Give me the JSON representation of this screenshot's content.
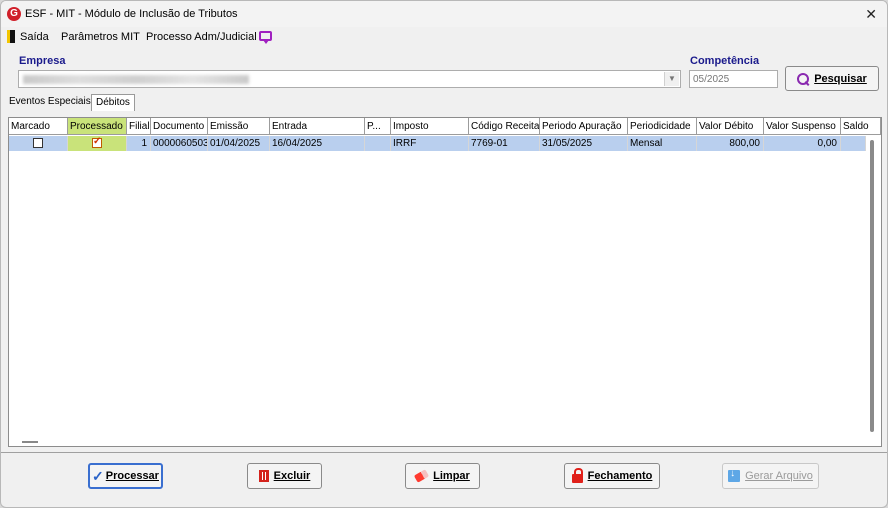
{
  "window": {
    "title": "ESF - MIT - Módulo de Inclusão de Tributos",
    "logo_letter": "G",
    "close_glyph": "✕"
  },
  "menu": {
    "items": [
      {
        "label": "Saída"
      },
      {
        "label": "Parâmetros MIT"
      },
      {
        "label": "Processo Adm/Judicial"
      }
    ]
  },
  "form": {
    "empresa_label": "Empresa",
    "competencia_label": "Competência",
    "competencia_value": "05/2025",
    "search_button": "Pesquisar"
  },
  "tabs": [
    {
      "label": "Eventos Especiais"
    },
    {
      "label": "Débitos",
      "active": true
    }
  ],
  "grid": {
    "columns": [
      "Marcado",
      "Processado",
      "Filial",
      "Documento",
      "Emissão",
      "Entrada",
      "P...",
      "Imposto",
      "Código Receita",
      "Periodo Apuração",
      "Periodicidade",
      "Valor Débito",
      "Valor Suspenso",
      "Saldo"
    ],
    "rows": [
      {
        "marcado": false,
        "processado": true,
        "filial": "1",
        "documento": "0000060503",
        "emissao": "01/04/2025",
        "entrada": "16/04/2025",
        "p": "",
        "imposto": "IRRF",
        "codigo_receita": "7769-01",
        "periodo_apuracao": "31/05/2025",
        "periodicidade": "Mensal",
        "valor_debito": "800,00",
        "valor_suspenso": "0,00",
        "saldo": ""
      }
    ]
  },
  "actions": {
    "processar": "Processar",
    "excluir": "Excluir",
    "limpar": "Limpar",
    "fechamento": "Fechamento",
    "gerar_arquivo": "Gerar Arquivo"
  },
  "colors": {
    "accent_purple": "#8a2ab0",
    "selected_row": "#b9cfee",
    "processado_highlight": "#c9e37a",
    "label_blue": "#1a1a8c"
  }
}
